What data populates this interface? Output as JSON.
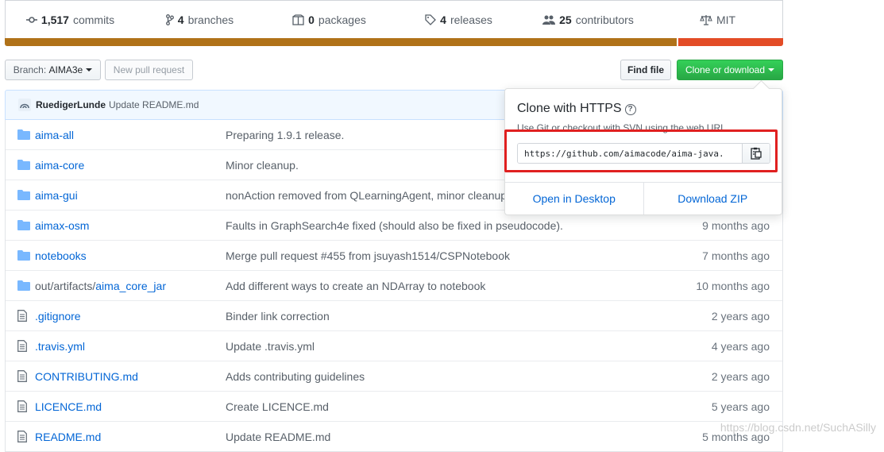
{
  "summary": {
    "commits": {
      "count": "1,517",
      "label": "commits"
    },
    "branches": {
      "count": "4",
      "label": "branches"
    },
    "packages": {
      "count": "0",
      "label": "packages"
    },
    "releases": {
      "count": "4",
      "label": "releases"
    },
    "contributors": {
      "count": "25",
      "label": "contributors"
    },
    "license": "MIT"
  },
  "colors": {
    "java": "#b07219",
    "other": "#e34c26",
    "accent_green": "#28a745",
    "link": "#0366d6"
  },
  "toolbar": {
    "branch_prefix": "Branch:",
    "branch_name": "AIMA3e",
    "new_pull_request": "New pull request",
    "find_file": "Find file",
    "clone_or_download": "Clone or download"
  },
  "commit": {
    "author": "RuedigerLunde",
    "message": "Update README.md"
  },
  "files": [
    {
      "type": "dir",
      "prefix": "",
      "name": "aima-all",
      "message": "Preparing 1.9.1 release.",
      "age": ""
    },
    {
      "type": "dir",
      "prefix": "",
      "name": "aima-core",
      "message": "Minor cleanup.",
      "age": ""
    },
    {
      "type": "dir",
      "prefix": "",
      "name": "aima-gui",
      "message": "nonAction removed from QLearningAgent, minor cleanup",
      "age": ""
    },
    {
      "type": "dir",
      "prefix": "",
      "name": "aimax-osm",
      "message": "Faults in GraphSearch4e fixed (should also be fixed in pseudocode).",
      "age": "9 months ago"
    },
    {
      "type": "dir",
      "prefix": "",
      "name": "notebooks",
      "message": "Merge pull request #455 from jsuyash1514/CSPNotebook",
      "age": "7 months ago"
    },
    {
      "type": "dir",
      "prefix": "out/artifacts/",
      "name": "aima_core_jar",
      "message": "Add different ways to create an NDArray to notebook",
      "age": "10 months ago"
    },
    {
      "type": "file",
      "prefix": "",
      "name": ".gitignore",
      "message": "Binder link correction",
      "age": "2 years ago"
    },
    {
      "type": "file",
      "prefix": "",
      "name": ".travis.yml",
      "message": "Update .travis.yml",
      "age": "4 years ago"
    },
    {
      "type": "file",
      "prefix": "",
      "name": "CONTRIBUTING.md",
      "message": "Adds contributing guidelines",
      "age": "2 years ago"
    },
    {
      "type": "file",
      "prefix": "",
      "name": "LICENCE.md",
      "message": "Create LICENCE.md",
      "age": "5 years ago"
    },
    {
      "type": "file",
      "prefix": "",
      "name": "README.md",
      "message": "Update README.md",
      "age": "5 months ago"
    }
  ],
  "clone_popup": {
    "title": "Clone with HTTPS",
    "help": "?",
    "subtitle": "Use Git or checkout with SVN using the web URL.",
    "url": "https://github.com/aimacode/aima-java.",
    "open_desktop": "Open in Desktop",
    "download_zip": "Download ZIP"
  },
  "watermark": "https://blog.csdn.net/SuchASilly"
}
